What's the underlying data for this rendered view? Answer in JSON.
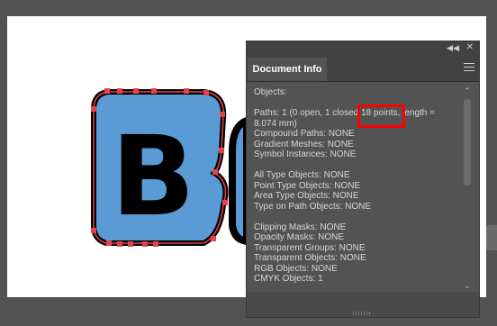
{
  "panel": {
    "title": "Document Info",
    "lines": [
      "Objects:",
      "",
      "Paths: 1 (0 open, 1 closed 18 points, length =",
      "8.074 mm)",
      "Compound Paths: NONE",
      "Gradient Meshes: NONE",
      "Symbol Instances: NONE",
      "",
      "All Type Objects: NONE",
      "Point Type Objects: NONE",
      "Area Type Objects: NONE",
      "Type on Path Objects: NONE",
      "",
      "Clipping Masks: NONE",
      "Opacity Masks: NONE",
      "Transparent Groups: NONE",
      "Transparent Objects: NONE",
      "RGB Objects: NONE",
      "CMYK Objects: 1"
    ],
    "highlighted_text": "18 points"
  },
  "canvas": {
    "letter_fill_color": "#5b9bd5",
    "anchor_color": "#e8404a",
    "highlight_color": "#ff0000"
  }
}
